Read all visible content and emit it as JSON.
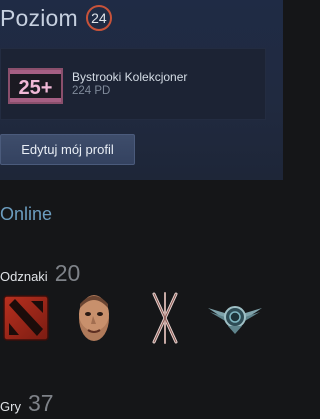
{
  "profile": {
    "level_label": "Poziom",
    "level_value": "24"
  },
  "featured_badge": {
    "icon": "collector-25-plus-badge-icon",
    "icon_text": "25+",
    "name": "Bystrooki Kolekcjoner",
    "xp": "224 PD"
  },
  "edit_profile_button": "Edytuj mój profil",
  "status": "Online",
  "badges_section": {
    "label": "Odznaki",
    "count": "20",
    "icons": [
      "dota-2-badge-icon",
      "face-portrait-badge-icon",
      "crossed-sticks-badge-icon",
      "winged-emblem-badge-icon"
    ]
  },
  "games_section": {
    "label": "Gry",
    "count": "37"
  },
  "colors": {
    "level_ring": "#c8533a",
    "status_online": "#6c9dbf",
    "collector_pink": "#e6a4c6",
    "background": "#151618"
  }
}
